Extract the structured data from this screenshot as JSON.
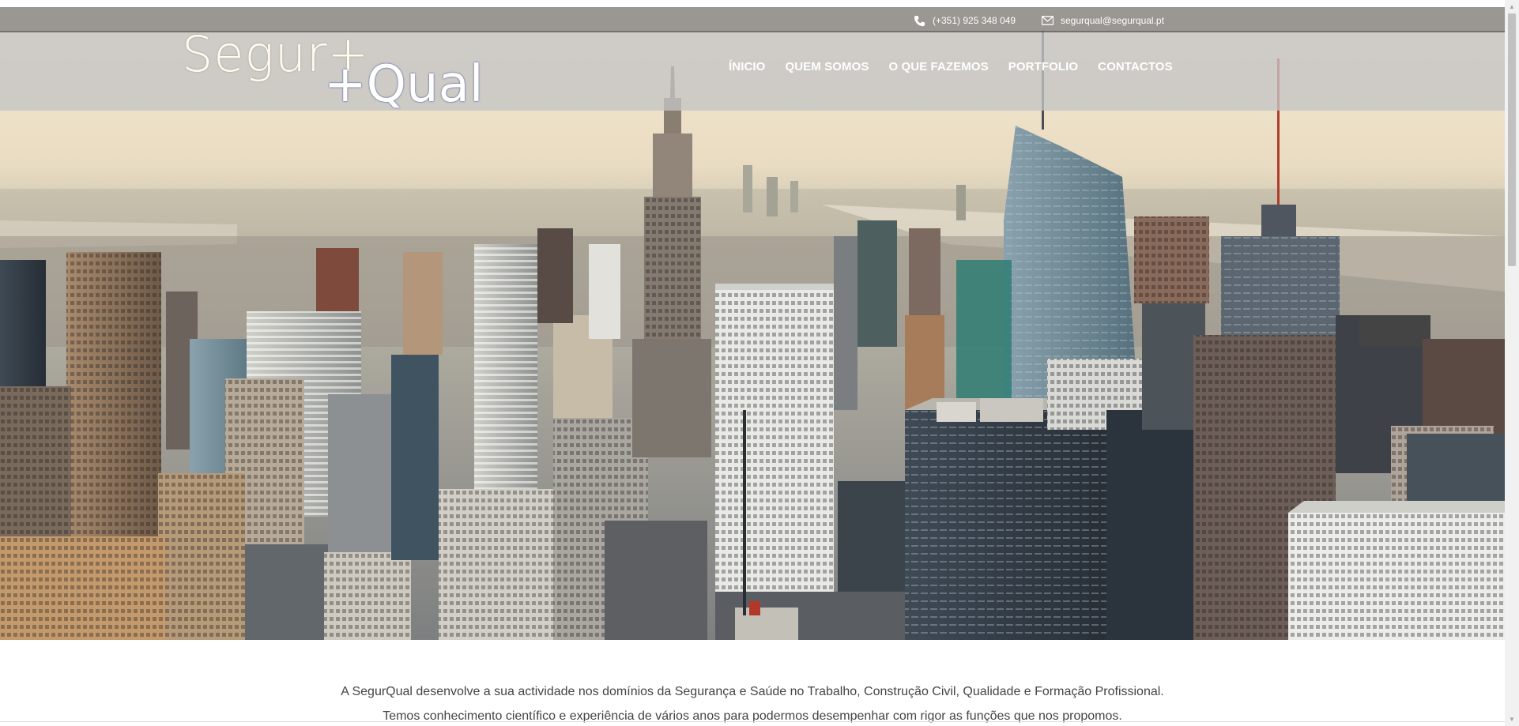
{
  "contact": {
    "phone": "(+351) 925 348 049",
    "email": "segurqual@segurqual.pt",
    "phone_icon": "phone-icon",
    "email_icon": "envelope-icon"
  },
  "logo": {
    "part1": "Segur+",
    "part2": "+Qual"
  },
  "nav": {
    "items": [
      {
        "label": "ÍNICIO"
      },
      {
        "label": "QUEM SOMOS"
      },
      {
        "label": "O QUE FAZEMOS"
      },
      {
        "label": "PORTFOLIO"
      },
      {
        "label": "CONTACTOS"
      }
    ]
  },
  "hero": {
    "image": "city-skyline-image"
  },
  "content": {
    "line1": "A SegurQual desenvolve a sua actividade nos domínios da Segurança e Saúde no Trabalho, Construção Civil, Qualidade e Formação Profissional.",
    "line2": "Temos conhecimento científico e experiência de vários anos para podermos desempenhar com rigor as funções que nos propomos."
  },
  "colors": {
    "contact_bar": "#808080",
    "header_bar": "#c4c4c4",
    "nav_text": "#ffffff",
    "body_text": "#444444"
  }
}
